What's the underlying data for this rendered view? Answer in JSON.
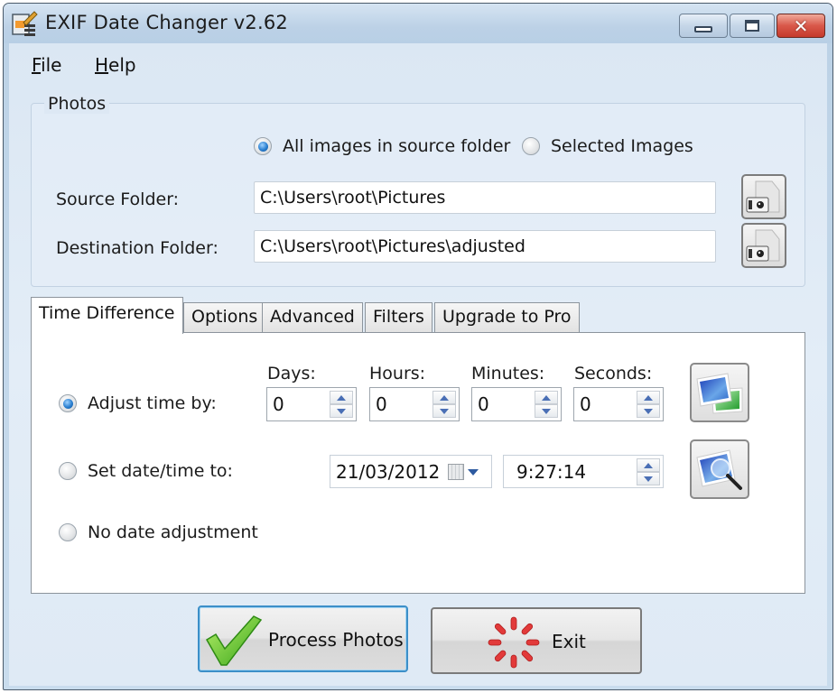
{
  "window": {
    "title": "EXIF Date Changer v2.62",
    "controls": {
      "minimize": "minimize",
      "maximize": "maximize",
      "close": "close"
    },
    "colors": {
      "accent": "#2a7fd0",
      "close_button": "#d9584a",
      "primary_border": "#3c8fc8"
    }
  },
  "menu": {
    "items": [
      {
        "label": "File",
        "accel": "F",
        "rest": "ile"
      },
      {
        "label": "Help",
        "accel": "H",
        "rest": "elp"
      }
    ]
  },
  "photos": {
    "group_title": "Photos",
    "mode_options": [
      {
        "label": "All images in source folder",
        "checked": true
      },
      {
        "label": "Selected Images",
        "checked": false
      }
    ],
    "source_folder": {
      "label": "Source Folder:",
      "value": "C:\\Users\\root\\Pictures",
      "browse_icon": "camera-folder-icon"
    },
    "destination_folder": {
      "label": "Destination Folder:",
      "value": "C:\\Users\\root\\Pictures\\adjusted",
      "browse_icon": "camera-folder-icon"
    }
  },
  "tabs": [
    {
      "label": "Time Difference",
      "active": true
    },
    {
      "label": "Options",
      "active": false
    },
    {
      "label": "Advanced",
      "active": false
    },
    {
      "label": "Filters",
      "active": false
    },
    {
      "label": "Upgrade to Pro",
      "active": false
    }
  ],
  "time_difference": {
    "adjust": {
      "label": "Adjust time by:",
      "checked": true,
      "fields": [
        {
          "label": "Days:",
          "value": "0"
        },
        {
          "label": "Hours:",
          "value": "0"
        },
        {
          "label": "Minutes:",
          "value": "0"
        },
        {
          "label": "Seconds:",
          "value": "0"
        }
      ],
      "action_icon": "photos-stack-icon"
    },
    "set_date": {
      "label": "Set date/time to:",
      "checked": false,
      "date": "21/03/2012",
      "time": "9:27:14",
      "action_icon": "photo-magnifier-icon"
    },
    "no_adjust": {
      "label": "No date adjustment",
      "checked": false
    }
  },
  "actions": {
    "process": {
      "label": "Process Photos",
      "icon": "green-checkmark-icon"
    },
    "exit": {
      "label": "Exit",
      "icon": "red-burst-icon"
    }
  }
}
